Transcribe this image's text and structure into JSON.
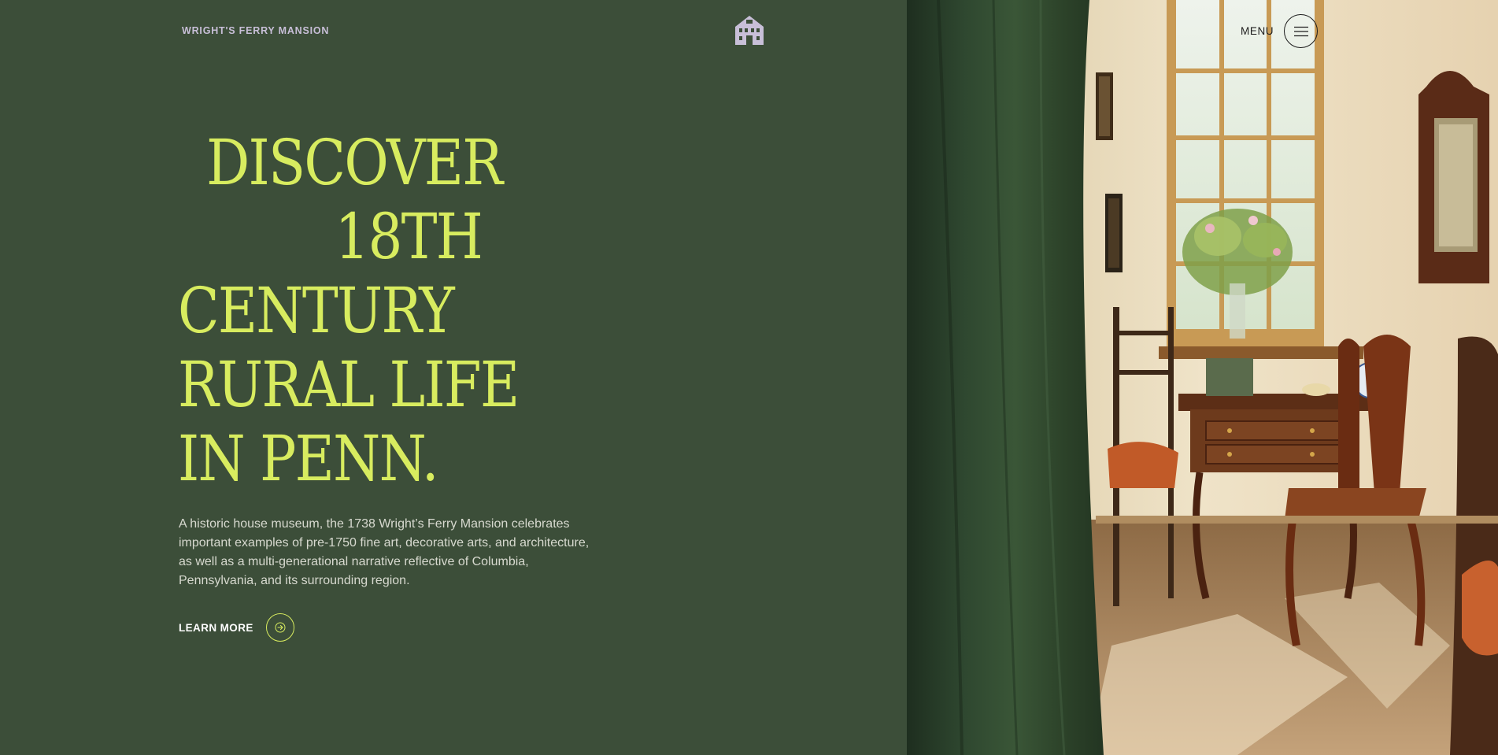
{
  "header": {
    "brand": "WRIGHT'S FERRY MANSION",
    "logo_icon": "house-icon",
    "menu_label": "MENU",
    "menu_icon": "hamburger-icon"
  },
  "hero": {
    "headline_lines": [
      "DISCOVER",
      "18TH",
      "CENTURY",
      "RURAL LIFE",
      "IN PENN."
    ],
    "description": "A historic house museum, the 1738 Wright’s Ferry Mansion celebrates important examples of pre-1750 fine art, decorative arts, and architecture, as well as a multi-generational narrative reflective of Columbia, Pennsylvania, and its surrounding region.",
    "cta_label": "LEARN MORE",
    "cta_icon": "arrow-right-icon"
  },
  "image": {
    "subject": "interior-room-icon"
  },
  "colors": {
    "background": "#3c4e39",
    "accent": "#d8ec5f",
    "brand_text": "#c8bfd8",
    "body_text": "#d7d9cf"
  }
}
